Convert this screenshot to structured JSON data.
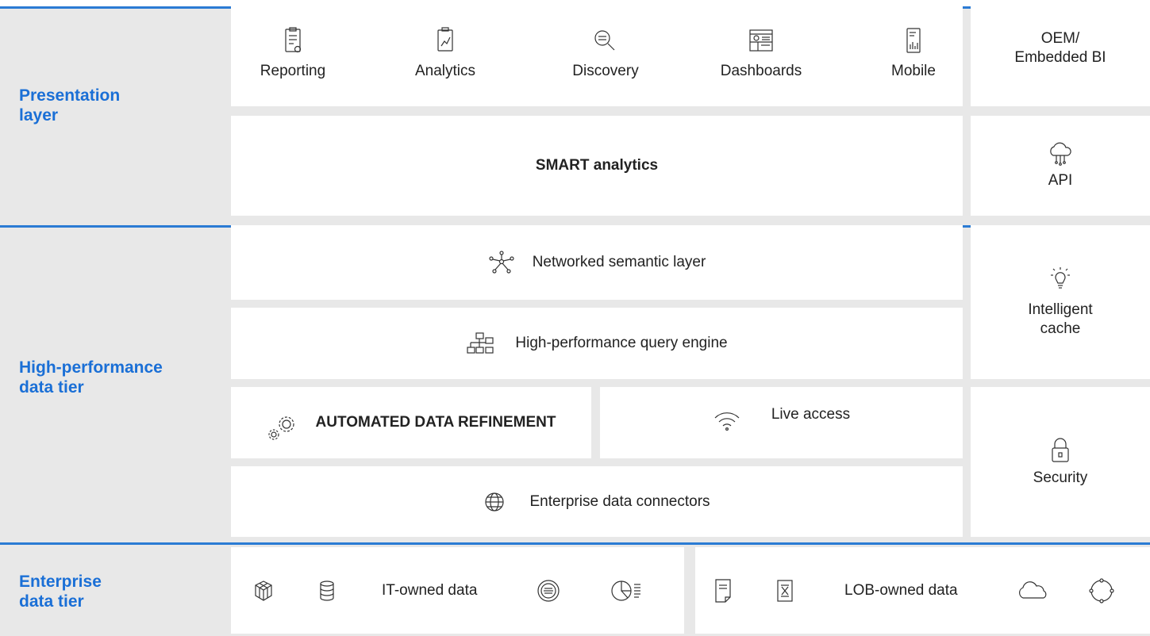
{
  "presentation": {
    "label_line1": "Presentation",
    "label_line2": "layer",
    "tools": [
      {
        "label": "Reporting",
        "icon": "clipboard-icon"
      },
      {
        "label": "Analytics",
        "icon": "chart-icon"
      },
      {
        "label": "Discovery",
        "icon": "search-icon"
      },
      {
        "label": "Dashboards",
        "icon": "dashboard-icon"
      },
      {
        "label": "Mobile",
        "icon": "mobile-icon"
      }
    ],
    "oem_line1": "OEM/",
    "oem_line2": "Embedded BI",
    "smart": "SMART analytics",
    "api": "API"
  },
  "data_tier": {
    "label_line1": "High-performance",
    "label_line2": "data tier",
    "semantic": "Networked semantic layer",
    "query": "High-performance query engine",
    "refinement": "AUTOMATED DATA REFINEMENT",
    "live": "Live access",
    "connectors": "Enterprise data connectors",
    "cache_line1": "Intelligent",
    "cache_line2": "cache",
    "security": "Security"
  },
  "enterprise": {
    "label_line1": "Enterprise",
    "label_line2": "data tier",
    "it_owned": "IT-owned data",
    "lob_owned": "LOB-owned data"
  },
  "colors": {
    "accent": "#1a6fd6",
    "divider": "#2b7bd4",
    "tier_bg": "#e8e8e8",
    "box_bg": "#ffffff"
  }
}
